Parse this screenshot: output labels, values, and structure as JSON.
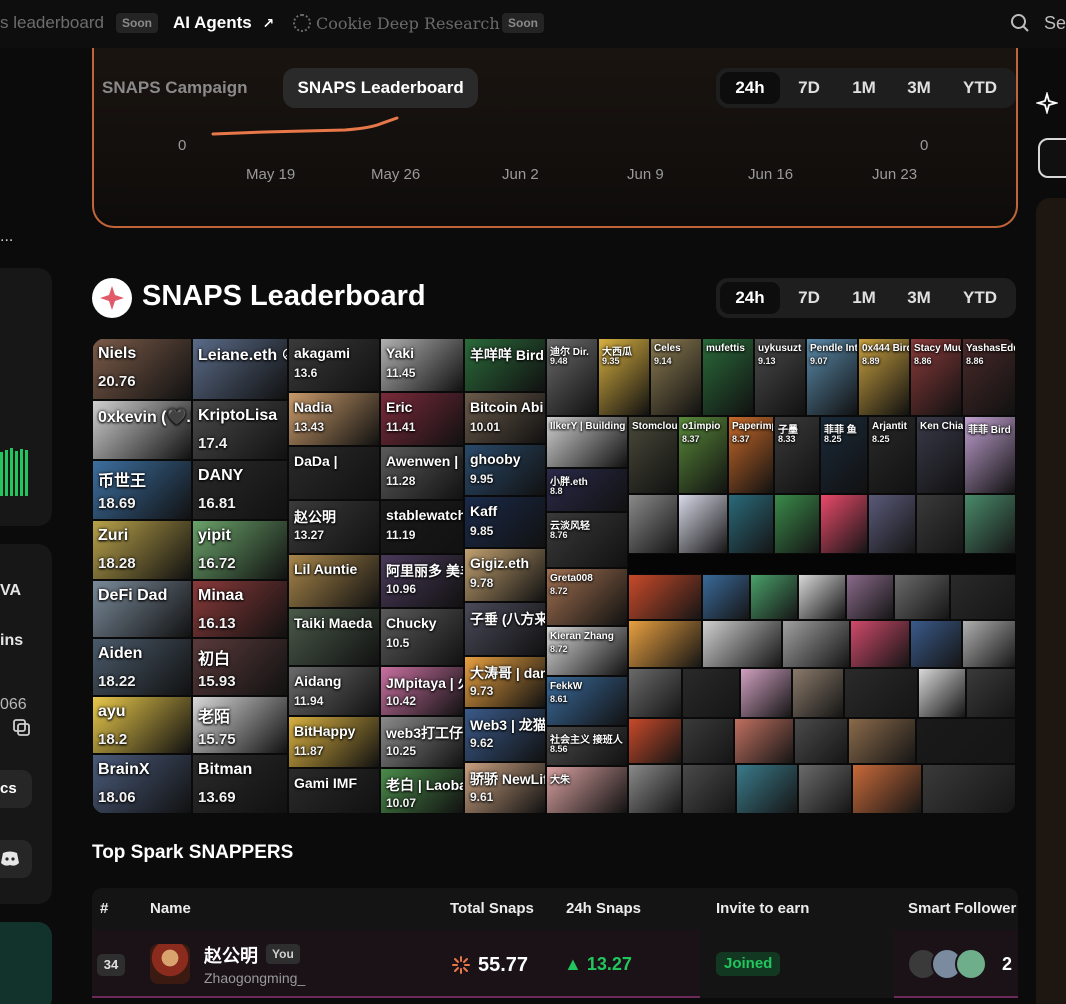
{
  "nav": {
    "leaderboard_partial": "s leaderboard",
    "soon1": "Soon",
    "ai_agents": "AI Agents",
    "ai_agents_arrow": "↗",
    "deep_research": "Cookie Deep Research",
    "soon2": "Soon",
    "search_partial": "Se"
  },
  "left": {
    "ellipsis": "...",
    "va": "VA",
    "ins": "ins",
    "num": "066",
    "cs": "cs"
  },
  "chart": {
    "tabs": [
      "SNAPS Campaign",
      "SNAPS Leaderboard"
    ],
    "ranges": [
      "24h",
      "7D",
      "1M",
      "3M",
      "YTD"
    ],
    "y_left": "0",
    "y_right": "0"
  },
  "chart_data": {
    "type": "line",
    "x": [
      "May 19",
      "May 26",
      "Jun 2",
      "Jun 9",
      "Jun 16",
      "Jun 23"
    ],
    "series": [],
    "y_left_label": "0",
    "y_right_label": "0",
    "line_color": "#e8784a"
  },
  "leaderboard": {
    "title": "SNAPS Leaderboard",
    "ranges": [
      "24h",
      "7D",
      "1M",
      "3M",
      "YTD"
    ],
    "tiles": [
      {
        "n": "Niels",
        "s": "20.76"
      },
      {
        "n": "Leiane.eth ☮",
        "s": ""
      },
      {
        "n": "0xkevin (🖤.💙)",
        "s": ""
      },
      {
        "n": "KriptoLisa",
        "s": "17.4"
      },
      {
        "n": "币世王",
        "s": "18.69"
      },
      {
        "n": "DANY",
        "s": "16.81"
      },
      {
        "n": "Zuri",
        "s": "18.28"
      },
      {
        "n": "yipit",
        "s": "16.72"
      },
      {
        "n": "DeFi Dad",
        "s": ""
      },
      {
        "n": "Minaa",
        "s": "16.13"
      },
      {
        "n": "Aiden",
        "s": "18.22"
      },
      {
        "n": "初白",
        "s": "15.93"
      },
      {
        "n": "ayu",
        "s": "18.2"
      },
      {
        "n": "老陌",
        "s": "15.75"
      },
      {
        "n": "BrainX",
        "s": "18.06"
      },
      {
        "n": "Bitman",
        "s": "13.69"
      },
      {
        "n": "akagami",
        "s": "13.6"
      },
      {
        "n": "Yaki",
        "s": "11.45"
      },
      {
        "n": "Nadia",
        "s": "13.43"
      },
      {
        "n": "Eric",
        "s": "11.41"
      },
      {
        "n": "DaDa |",
        "s": ""
      },
      {
        "n": "Awenwen | Bird",
        "s": "11.28"
      },
      {
        "n": "赵公明",
        "s": "13.27"
      },
      {
        "n": "stablewatch",
        "s": "11.19"
      },
      {
        "n": "Lil Auntie",
        "s": ""
      },
      {
        "n": "阿里丽多 美羊羊桑",
        "s": "10.96"
      },
      {
        "n": "Taiki Maeda",
        "s": ""
      },
      {
        "n": "Chucky",
        "s": "10.5"
      },
      {
        "n": "Aidang",
        "s": "11.94"
      },
      {
        "n": "JMpitaya | 火龙果",
        "s": "10.42"
      },
      {
        "n": "BitHappy",
        "s": "11.87"
      },
      {
        "n": "web3打工仔",
        "s": "10.25"
      },
      {
        "n": "Gami IMF",
        "s": ""
      },
      {
        "n": "老白 | Laobai",
        "s": "10.07"
      },
      {
        "n": "羊咩咩 Bird",
        "s": ""
      },
      {
        "n": "Bitcoin Abi",
        "s": "10.01"
      },
      {
        "n": "ghooby",
        "s": "9.95"
      },
      {
        "n": "Kaff",
        "s": "9.85"
      },
      {
        "n": "Gigiz.eth",
        "s": "9.78"
      },
      {
        "n": "子垂 (八方来财版",
        "s": ""
      },
      {
        "n": "大涛哥 | damo.eth",
        "s": "9.73"
      },
      {
        "n": "Web3 | 龙猫",
        "s": "9.62"
      },
      {
        "n": "骄骄 NewLife",
        "s": "9.61"
      },
      {
        "n": "迪尔 Dir.",
        "s": "9.48"
      },
      {
        "n": "大西瓜",
        "s": "9.35"
      },
      {
        "n": "Celes",
        "s": "9.14"
      },
      {
        "n": "mufettis",
        "s": ""
      },
      {
        "n": "uykusuzt",
        "s": "9.13"
      },
      {
        "n": "Pendle Intern",
        "s": "9.07"
      },
      {
        "n": "0x444 Bird",
        "s": "8.89"
      },
      {
        "n": "Stacy Muur",
        "s": "8.86"
      },
      {
        "n": "YashasEdu",
        "s": "8.86"
      },
      {
        "n": "IlkerY | Building",
        "s": ""
      },
      {
        "n": "Stomcloud",
        "s": ""
      },
      {
        "n": "o1impio",
        "s": "8.37"
      },
      {
        "n": "Paperimpera",
        "s": "8.37"
      },
      {
        "n": "子墨",
        "s": "8.33"
      },
      {
        "n": "菲菲 鱼",
        "s": "8.25"
      },
      {
        "n": "Arjantit",
        "s": "8.25"
      },
      {
        "n": "Ken Chia Pendle",
        "s": ""
      },
      {
        "n": "菲菲 Bird",
        "s": ""
      },
      {
        "n": "小胖.eth",
        "s": "8.8"
      },
      {
        "n": "云淡风轻",
        "s": "8.76"
      },
      {
        "n": "Greta008",
        "s": "8.72"
      },
      {
        "n": "Kieran Zhang",
        "s": "8.72"
      },
      {
        "n": "FekkW",
        "s": "8.61"
      },
      {
        "n": "社会主义 接班人",
        "s": "8.56"
      },
      {
        "n": "大朱",
        "s": ""
      }
    ]
  },
  "table": {
    "title": "Top Spark SNAPPERS",
    "headers": [
      "#",
      "Name",
      "Total Snaps",
      "24h Snaps",
      "Invite to earn",
      "Smart Follower"
    ],
    "row": {
      "rank": "34",
      "name": "赵公明",
      "you": "You",
      "handle": "Zhaogongming_",
      "total": "55.77",
      "h24": "▲ 13.27",
      "invite": "Joined",
      "followers_partial": "2"
    }
  }
}
